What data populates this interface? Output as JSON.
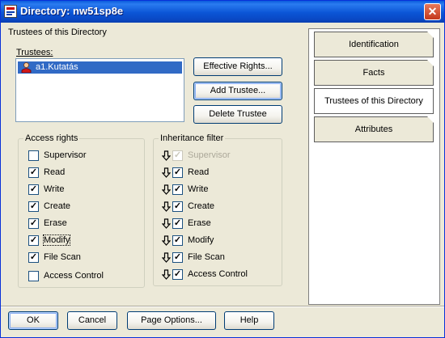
{
  "window": {
    "title": "Directory: nw51sp8e",
    "close_glyph": "✕"
  },
  "main": {
    "group_title": "Trustees of this Directory",
    "trustees_label": "Trustees:",
    "trustees": [
      {
        "name": "a1.Kutatás",
        "selected": true,
        "icon": "user-icon"
      }
    ],
    "buttons": {
      "effective_rights": "Effective Rights...",
      "add_trustee": "Add Trustee...",
      "delete_trustee": "Delete Trustee"
    },
    "access_rights": {
      "legend": "Access rights",
      "items": [
        {
          "label": "Supervisor",
          "checked": false
        },
        {
          "label": "Read",
          "checked": true
        },
        {
          "label": "Write",
          "checked": true
        },
        {
          "label": "Create",
          "checked": true
        },
        {
          "label": "Erase",
          "checked": true
        },
        {
          "label": "Modify",
          "checked": true
        },
        {
          "label": "File Scan",
          "checked": true
        },
        {
          "label": "Access Control",
          "checked": false
        }
      ]
    },
    "inheritance_filter": {
      "legend": "Inheritance filter",
      "items": [
        {
          "label": "Supervisor",
          "checked": true,
          "disabled": true
        },
        {
          "label": "Read",
          "checked": true
        },
        {
          "label": "Write",
          "checked": true
        },
        {
          "label": "Create",
          "checked": true
        },
        {
          "label": "Erase",
          "checked": true
        },
        {
          "label": "Modify",
          "checked": true
        },
        {
          "label": "File Scan",
          "checked": true
        },
        {
          "label": "Access Control",
          "checked": true
        }
      ]
    }
  },
  "side_tabs": [
    {
      "label": "Identification",
      "active": false
    },
    {
      "label": "Facts",
      "active": false
    },
    {
      "label": "Trustees of this Directory",
      "active": true
    },
    {
      "label": "Attributes",
      "active": false
    }
  ],
  "footer": {
    "ok": "OK",
    "cancel": "Cancel",
    "page_options": "Page Options...",
    "help": "Help"
  },
  "colors": {
    "titlebar": "#0a48c4",
    "selection": "#316ac5",
    "face": "#ece9d8"
  }
}
